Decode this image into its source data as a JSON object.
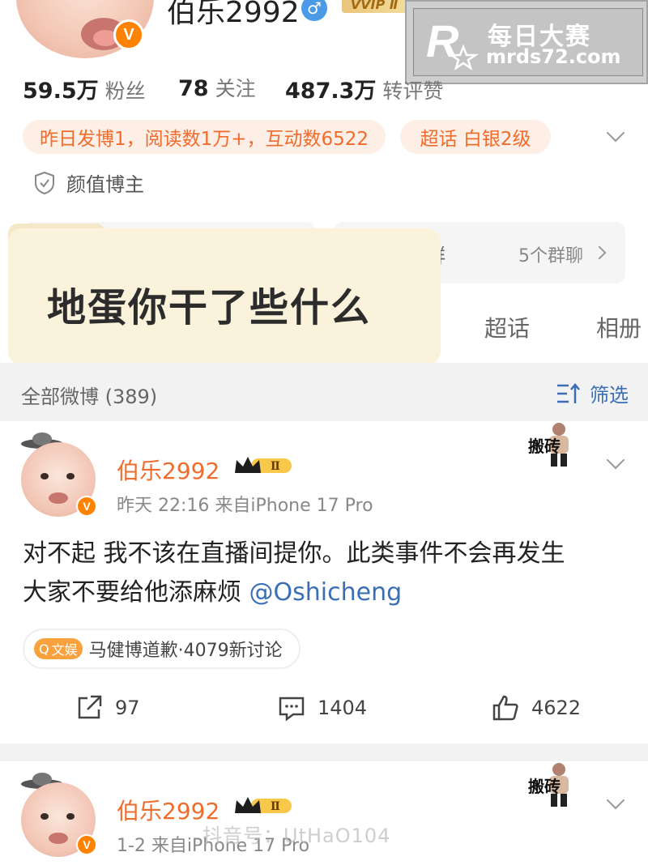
{
  "profile": {
    "name": "伯乐2992",
    "gender_icon": "male-icon",
    "vip_badge": "VVIP Ⅱ",
    "verified_icon": "V",
    "stats": [
      {
        "value": "59.5万",
        "label": "粉丝"
      },
      {
        "value": "78",
        "label": "关注"
      },
      {
        "value": "487.3万",
        "label": "转评赞"
      }
    ],
    "activity_pill": "昨日发博1，阅读数1万+，互动数6522",
    "superchat_pill": "超话 白银2级",
    "tag": "颜值博主",
    "group_partial": "群",
    "group_count": "5个群聊"
  },
  "watermark": {
    "logo": "R",
    "line1": "每日大赛",
    "line2": "mrds72.com"
  },
  "sticker": {
    "text": "地蛋你干了些什么"
  },
  "tabs": [
    "超话",
    "相册"
  ],
  "filter": {
    "all_label": "全部微博 (389)",
    "filter_label": "筛选"
  },
  "posts": [
    {
      "author": "伯乐2992",
      "rank_badge": "Ⅱ",
      "meta": "昨天 22:16  来自iPhone 17 Pro",
      "meme_label": "搬砖",
      "text_line1": "对不起 我不该在直播间提你。此类事件不会再发生",
      "text_line2": "大家不要给他添麻烦 ",
      "mention": "@Oshicheng",
      "topic_badge": "文娱",
      "topic_text": "马健博道歉·4079新讨论",
      "reposts": "97",
      "comments": "1404",
      "likes": "4622"
    },
    {
      "author": "伯乐2992",
      "rank_badge": "Ⅱ",
      "meta": "1-2  来自iPhone 17 Pro",
      "meme_label": "搬砖"
    }
  ],
  "faint_watermark": "抖音号：UtHaO104",
  "colors": {
    "accent_orange": "#f06c2c",
    "link_blue": "#3a6fb7",
    "verified_orange": "#ff8200"
  }
}
